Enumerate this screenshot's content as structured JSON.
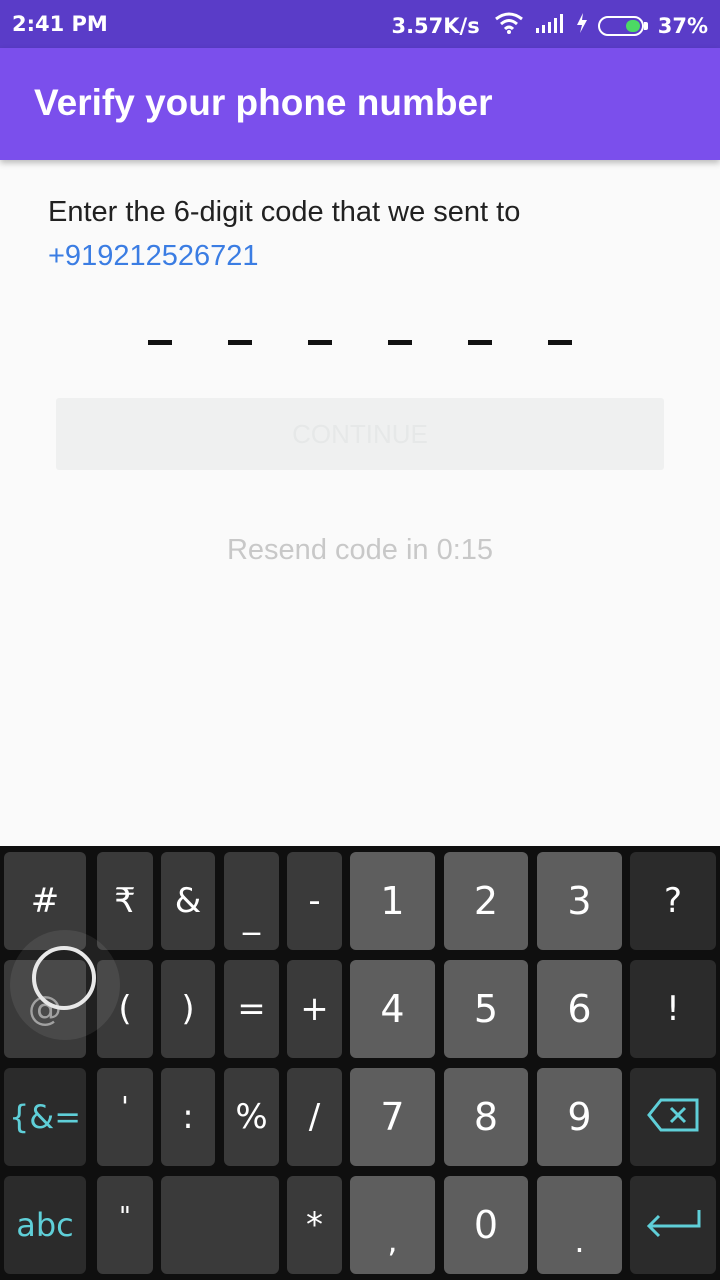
{
  "status_bar": {
    "time": "2:41 PM",
    "speed": "3.57K/s",
    "battery": "37%"
  },
  "app_bar": {
    "title": "Verify your phone number"
  },
  "content": {
    "instruction": "Enter the 6-digit code that we sent to",
    "phone": "+919212526721",
    "code_slots": [
      "–",
      "–",
      "–",
      "–",
      "–",
      "–"
    ],
    "continue_label": "CONTINUE",
    "resend_text": "Resend code in 0:15"
  },
  "keyboard": {
    "row1": [
      "#",
      "₹",
      "&",
      "_",
      "-",
      "1",
      "2",
      "3",
      "?"
    ],
    "row2": [
      "@",
      "(",
      ")",
      "=",
      "+",
      "4",
      "5",
      "6",
      "!"
    ],
    "row3": [
      "{&=",
      "'",
      ":",
      "%",
      "/",
      "7",
      "8",
      "9"
    ],
    "row4": [
      "abc",
      "\"",
      "*",
      ",",
      "0",
      "."
    ],
    "backspace_icon": "backspace-icon",
    "enter_icon": "enter-icon"
  }
}
